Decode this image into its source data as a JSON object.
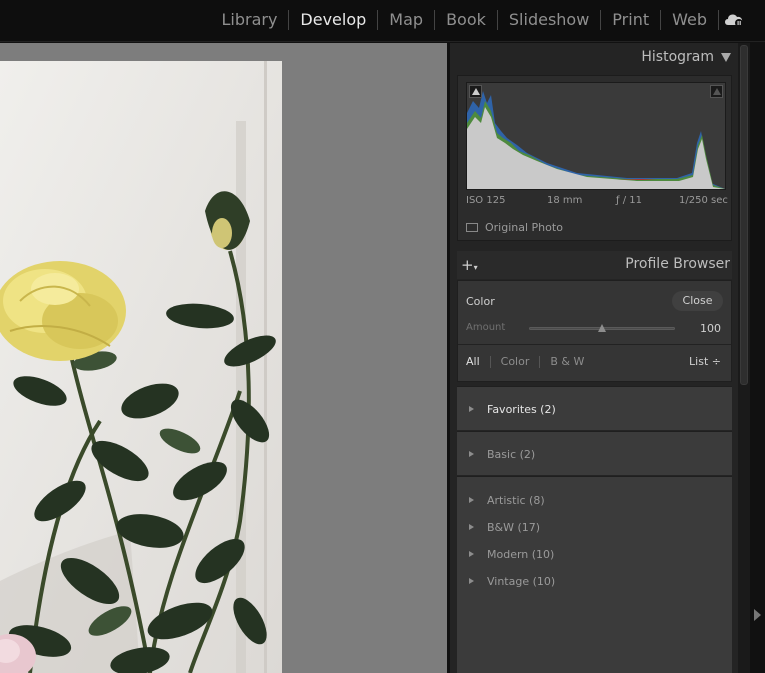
{
  "modules": [
    "Library",
    "Develop",
    "Map",
    "Book",
    "Slideshow",
    "Print",
    "Web"
  ],
  "active_module": "Develop",
  "histogram": {
    "title": "Histogram",
    "iso": "ISO 125",
    "focal": "18 mm",
    "aperture": "ƒ / 11",
    "shutter": "1/250 sec",
    "original_photo_label": "Original Photo"
  },
  "profile_browser": {
    "title": "Profile Browser",
    "color_label": "Color",
    "close_label": "Close",
    "amount_label": "Amount",
    "amount_value": "100",
    "amount_fraction": 0.5,
    "filters": [
      "All",
      "Color",
      "B & W"
    ],
    "active_filter": "All",
    "view_label": "List ÷",
    "groups": [
      {
        "label": "Favorites (2)"
      },
      {
        "label": "Basic (2)"
      },
      {
        "label": "Artistic (8)"
      },
      {
        "label": "B&W (17)"
      },
      {
        "label": "Modern (10)"
      },
      {
        "label": "Vintage (10)"
      }
    ]
  }
}
